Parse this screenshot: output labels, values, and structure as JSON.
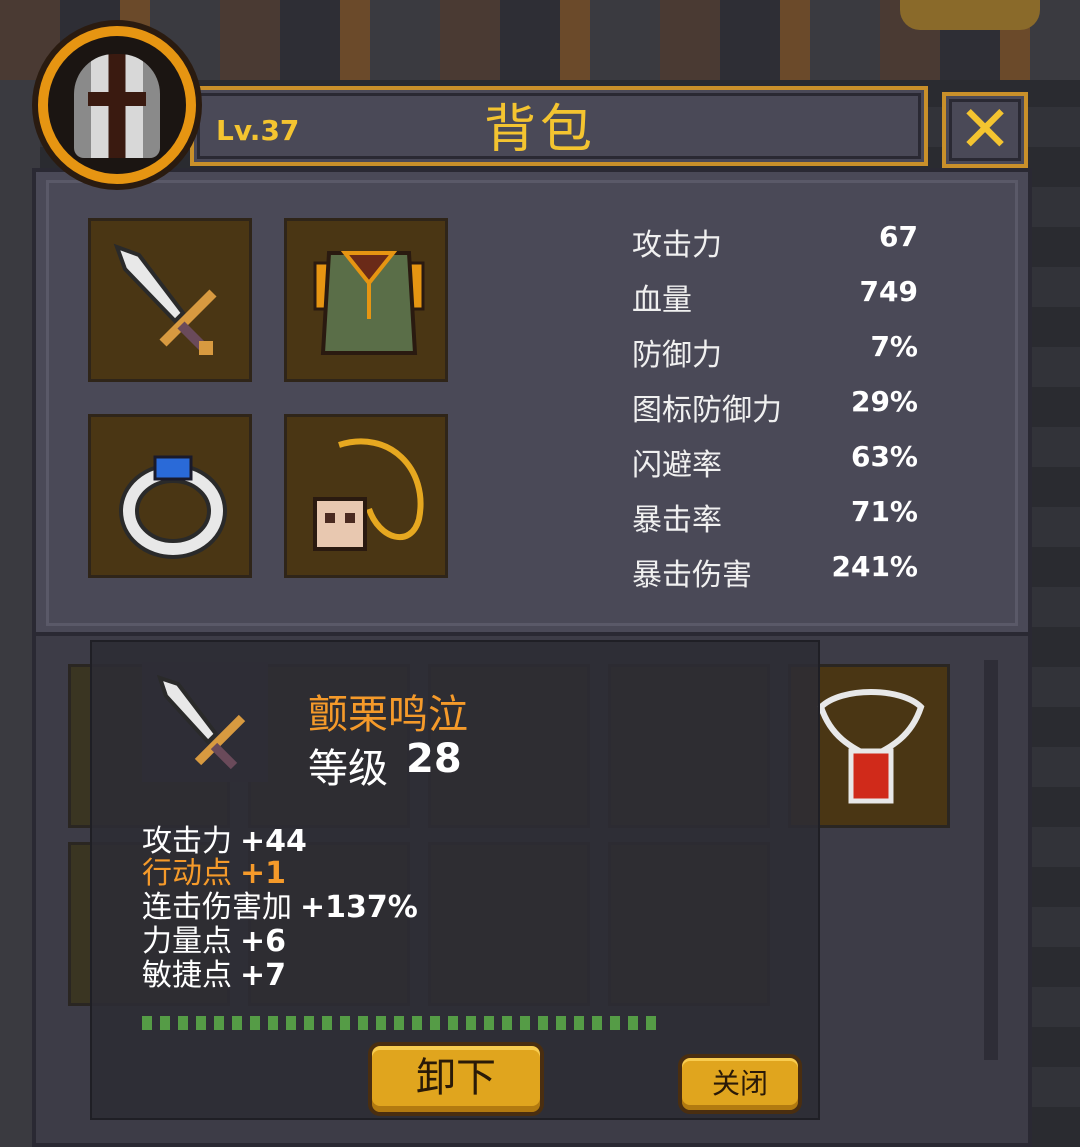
{
  "header": {
    "title": "背包",
    "level": "Lv.37",
    "close_icon": "close-x-icon"
  },
  "equipment": {
    "slots": [
      {
        "name": "weapon-slot",
        "icon": "dagger-icon"
      },
      {
        "name": "armor-slot",
        "icon": "chest-armor-icon"
      },
      {
        "name": "ring-slot",
        "icon": "ring-icon"
      },
      {
        "name": "amulet-slot",
        "icon": "skull-necklace-icon"
      }
    ]
  },
  "stats": [
    {
      "label": "攻击力",
      "value": "67"
    },
    {
      "label": "血量",
      "value": "749"
    },
    {
      "label": "防御力",
      "value": "7%"
    },
    {
      "label": "图标防御力",
      "value": "29%"
    },
    {
      "label": "闪避率",
      "value": "63%"
    },
    {
      "label": "暴击率",
      "value": "71%"
    },
    {
      "label": "暴击伤害",
      "value": "241%"
    }
  ],
  "tooltip": {
    "item_name": "颤栗鸣泣",
    "level_label": "等级",
    "level_value": "28",
    "attributes": [
      {
        "key": "攻击力",
        "value": "+44",
        "color": "#ffffff"
      },
      {
        "key": "行动点",
        "value": "+1",
        "color": "#f59a2a"
      },
      {
        "key": "连击伤害加",
        "value": "+137%",
        "color": "#ffffff"
      },
      {
        "key": "力量点",
        "value": "+6",
        "color": "#ffffff"
      },
      {
        "key": "敏捷点",
        "value": "+7",
        "color": "#ffffff"
      }
    ],
    "unequip_label": "卸下",
    "close_label": "关闭"
  },
  "colors": {
    "accent": "#f4c430",
    "item_name": "#f59a2a",
    "panel": "#4a4957"
  }
}
